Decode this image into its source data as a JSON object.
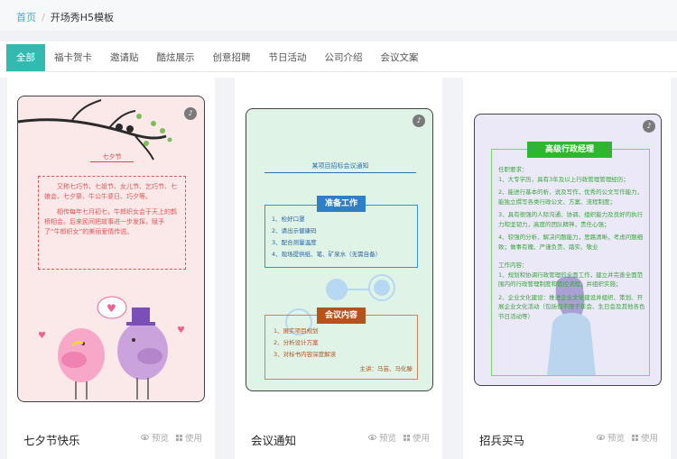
{
  "breadcrumb": {
    "home": "首页",
    "sep": "/",
    "current": "开场秀H5模板"
  },
  "tabs": [
    "全部",
    "福卡贺卡",
    "邀请贴",
    "酷炫展示",
    "创意招聘",
    "节日活动",
    "公司介绍",
    "会议文案"
  ],
  "actions": {
    "preview": "预览",
    "use": "使用"
  },
  "cards": [
    {
      "title": "七夕节快乐",
      "preview": {
        "heading": "七夕节",
        "p1": "又称七巧节、七姐节、女儿节、乞巧节、七娘会、七夕祭、牛公牛婆日、巧夕等。",
        "p2": "相传每年七月初七，牛郎织女会于天上的鹊桥相会。后来民间把故事进一步发挥，赋予了“牛郎织女”的美丽爱情传说。"
      }
    },
    {
      "title": "会议通知",
      "preview": {
        "heading": "某项目招标会议通知",
        "sec1": "准备工作",
        "items1": [
          "1、检好口罩",
          "2、请出示健康码",
          "3、配合测量温度",
          "4、现场提供纸、笔、矿泉水（无需自备）"
        ],
        "sec2": "会议内容",
        "items2": [
          "1、展实项目规划",
          "2、分析设计方案",
          "3、对标书内容深度解读"
        ],
        "speaker": "主讲：马芸、马化滕"
      }
    },
    {
      "title": "招兵买马",
      "preview": {
        "heading": "高级行政经理",
        "req_title": "任职要求：",
        "reqs": [
          "1、大专学历，具有3年及以上行政管理管理经历；",
          "2、能进行基本的析、说及写作，优秀的公文写作能力，能独立撰写各类行政公文、方案、流程制度；",
          "3、具有很强的人际沟通、协调、组织能力及良好的执行力和坚韧力，高度的团队精神，责任心强；",
          "4、较强的分析、解决问题能力，思路清晰，考虑问题细致；做事有魄、严谨负责、踏实、敬业"
        ],
        "duty_title": "工作内容：",
        "duties": [
          "1、规划和协调行政管理的全面工作，建立并完善全面范围内的行政管理制度和管控流程，并组织实施；",
          "2、企业文化建设：推进企业文化建设并组织、策划、开展企业文化活动（包括但不限于年会、生日会及其他各色节日活动等）"
        ]
      }
    }
  ],
  "colors": {
    "accent": "#32b9b0",
    "link": "#3aaecf"
  }
}
